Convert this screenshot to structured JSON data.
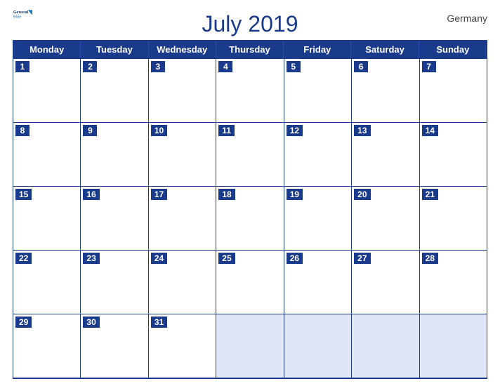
{
  "header": {
    "title": "July 2019",
    "country": "Germany",
    "logo_general": "General",
    "logo_blue": "Blue"
  },
  "days": [
    "Monday",
    "Tuesday",
    "Wednesday",
    "Thursday",
    "Friday",
    "Saturday",
    "Sunday"
  ],
  "weeks": [
    [
      1,
      2,
      3,
      4,
      5,
      6,
      7
    ],
    [
      8,
      9,
      10,
      11,
      12,
      13,
      14
    ],
    [
      15,
      16,
      17,
      18,
      19,
      20,
      21
    ],
    [
      22,
      23,
      24,
      25,
      26,
      27,
      28
    ],
    [
      29,
      30,
      31,
      null,
      null,
      null,
      null
    ]
  ],
  "colors": {
    "header_bg": "#1a3a8c",
    "accent": "#1a7abf",
    "empty_bg": "#e0e6f5"
  }
}
